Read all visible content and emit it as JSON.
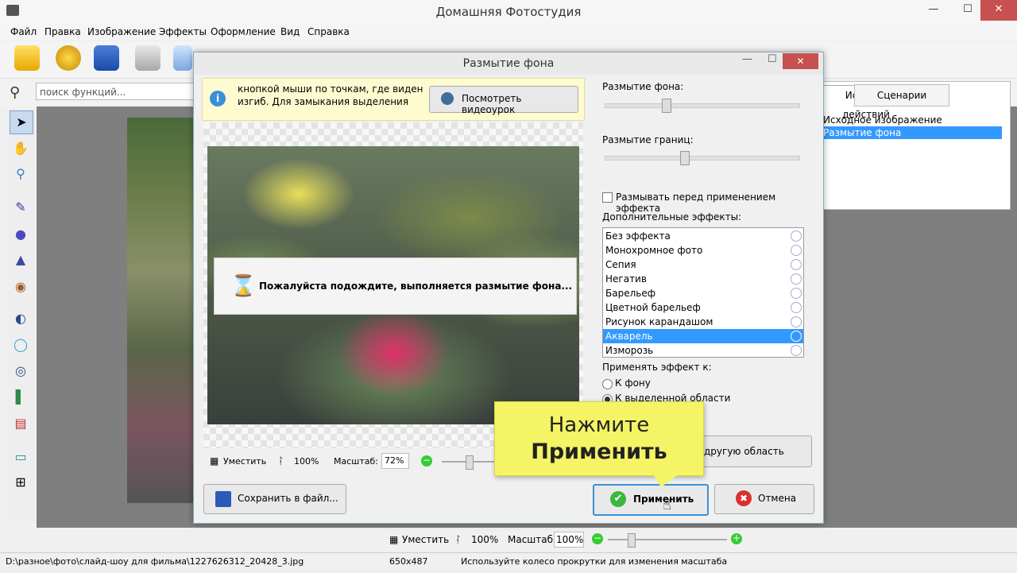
{
  "window": {
    "title": "Домашняя Фотостудия",
    "minimize": "—",
    "maximize": "☐",
    "close": "✕"
  },
  "menu": [
    "Файл",
    "Правка",
    "Изображение",
    "Эффекты",
    "Оформление",
    "Вид",
    "Справка"
  ],
  "search": {
    "placeholder": "поиск функций..."
  },
  "tabs": {
    "history": "История действий",
    "scenarios": "Сценарии"
  },
  "history": [
    "Исходное изображение",
    "Размытие фона"
  ],
  "main_zoom": {
    "fit": "Уместить",
    "actual": "100%",
    "scale_label": "Масштаб:",
    "scale_value": "100%"
  },
  "status": {
    "path": "D:\\разное\\фото\\слайд-шоу для фильма\\1227626312_20428_3.jpg",
    "size": "650x487",
    "hint": "Используйте колесо прокрутки для изменения масштаба"
  },
  "dialog": {
    "title": "Размытие фона",
    "info": "кнопкой мыши по точкам, где виден изгиб. Для замыкания выделения",
    "video_button": "Посмотреть видеоурок",
    "wait_message": "Пожалуйста подождите, выполняется размытие фона...",
    "zoom": {
      "fit": "Уместить",
      "actual": "100%",
      "scale_label": "Масштаб:",
      "scale_value": "72%"
    },
    "blur_bg_label": "Размытие фона:",
    "blur_edges_label": "Размытие границ:",
    "blur_before_label": "Размывать перед применением эффекта",
    "extra_effects_label": "Дополнительные эффекты:",
    "effects": [
      "Без эффекта",
      "Монохромное фото",
      "Сепия",
      "Негатив",
      "Барельеф",
      "Цветной барельеф",
      "Рисунок карандашом",
      "Акварель",
      "Изморозь"
    ],
    "selected_effect": "Акварель",
    "apply_to_label": "Применять эффект к:",
    "apply_to": [
      "К фону",
      "К выделенной области"
    ],
    "other_area_button": "другую область",
    "save_button": "Сохранить в файл...",
    "apply_button": "Применить",
    "cancel_button": "Отмена"
  },
  "callout": {
    "line1": "Нажмите",
    "line2": "Применить"
  },
  "colors": {
    "accent": "#3399ff",
    "callout": "#f4f466",
    "close": "#c75050"
  }
}
